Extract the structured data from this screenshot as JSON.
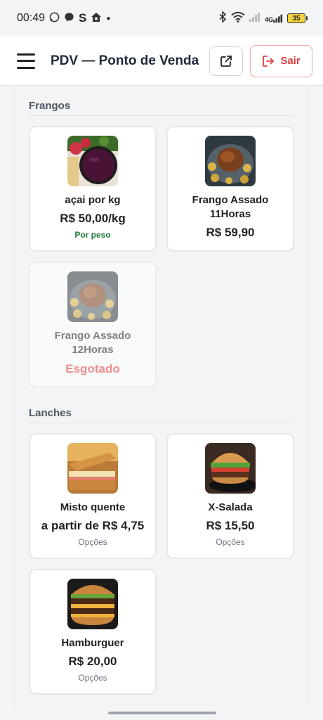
{
  "status_bar": {
    "time": "00:49",
    "left_icons": [
      "whatsapp-icon",
      "messenger-icon",
      "s-app-icon",
      "home-icon",
      "dot-icon"
    ],
    "right_icons": [
      "bluetooth-icon",
      "wifi-icon",
      "signal-icon",
      "4g-signal-icon",
      "battery-icon"
    ],
    "network": "4G",
    "battery": "35"
  },
  "header": {
    "menu_icon": "hamburger-icon",
    "title": "PDV — Ponto de Venda",
    "external_icon": "external-link-icon",
    "logout_icon": "logout-icon",
    "logout_label": "Sair"
  },
  "sections": [
    {
      "title": "Frangos",
      "products": [
        {
          "name": "açai por kg",
          "price": "R$ 50,00/kg",
          "note": "Por peso",
          "status": "available"
        },
        {
          "name": "Frango Assado 11Horas",
          "price": "R$ 59,90",
          "status": "available"
        },
        {
          "name": "Frango Assado 12Horas",
          "status_label": "Esgotado",
          "status": "out"
        }
      ]
    },
    {
      "title": "Lanches",
      "products": [
        {
          "name": "Misto quente",
          "price": "a partir de R$ 4,75",
          "note": "Opções",
          "status": "available"
        },
        {
          "name": "X-Salada",
          "price": "R$ 15,50",
          "note": "Opções",
          "status": "available"
        },
        {
          "name": "Hamburguer",
          "price": "R$ 20,00",
          "note": "Opções",
          "status": "available"
        }
      ]
    }
  ],
  "colors": {
    "accent_red": "#e03c3c",
    "weight_green": "#1e7a3a",
    "background": "#f3f4f6"
  }
}
